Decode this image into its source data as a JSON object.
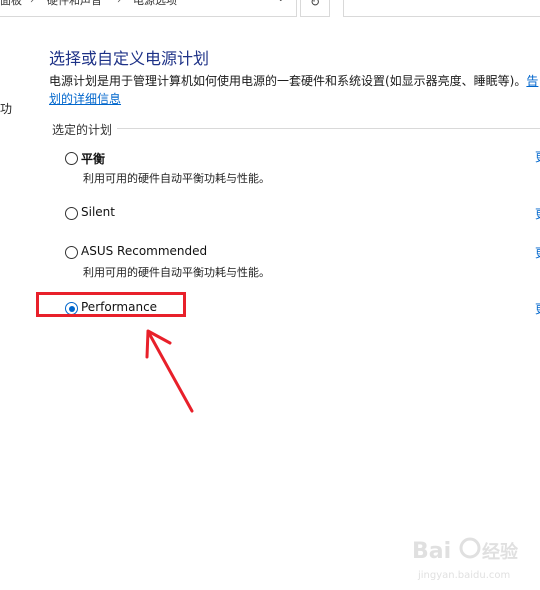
{
  "address_bar": {
    "segments": [
      "面板",
      "硬件和声音",
      "电源选项"
    ]
  },
  "left_sidebar": {
    "cut_text": "功"
  },
  "page": {
    "title": "选择或自定义电源计划",
    "description": "电源计划是用于管理计算机如何使用电源的一套硬件和系统设置(如显示器亮度、睡眠等)。",
    "description_link_part1": "告",
    "description_link_part2": "划的详细信息"
  },
  "section": {
    "label": "选定的计划"
  },
  "plans": [
    {
      "name": "平衡",
      "description": "利用可用的硬件自动平衡功耗与性能。",
      "selected": false,
      "change_label": "更"
    },
    {
      "name": "Silent",
      "description": "",
      "selected": false,
      "change_label": "更"
    },
    {
      "name": "ASUS Recommended",
      "description": "利用可用的硬件自动平衡功耗与性能。",
      "selected": false,
      "change_label": "更"
    },
    {
      "name": "Performance",
      "description": "",
      "selected": true,
      "change_label": "更"
    }
  ],
  "colors": {
    "accent": "#0066cc",
    "highlight": "#e8202a",
    "title": "#1e3287"
  },
  "icons": {
    "refresh": "refresh-icon",
    "dropdown": "chevron-down-icon"
  }
}
